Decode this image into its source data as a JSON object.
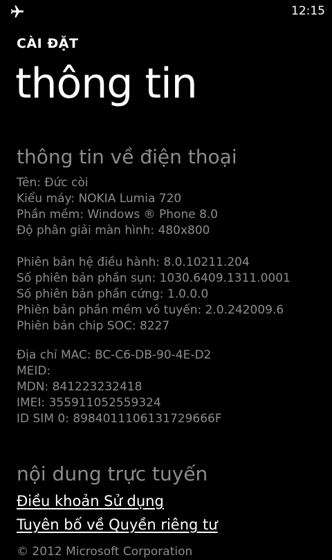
{
  "status_bar": {
    "airplane_icon": "airplane-icon",
    "time": "12:15"
  },
  "header": {
    "app_title": "CÀI ĐẶT",
    "page_title": "thông tin"
  },
  "phone_info": {
    "section_title": "thông tin về điện thoại",
    "basic": [
      "Tên: Đức còi",
      "Kiểu máy: NOKIA Lumia 720",
      "Phần mềm: Windows ® Phone 8.0",
      "Độ phân giải màn hình: 480x800"
    ],
    "versions": [
      "Phiên bản hệ điều hành: 8.0.10211.204",
      "Số phiên bản phần sụn: 1030.6409.1311.0001",
      "Số phiên bản phần cứng: 1.0.0.0",
      "Phiên bản phần mềm vô tuyến: 2.0.242009.6",
      "Phiên bản chip SOC: 8227"
    ],
    "identifiers": [
      "Địa chỉ MAC: BC-C6-DB-90-4E-D2",
      "MEID:",
      "MDN: 841223232418",
      "IMEI: 355911052559324",
      "ID SIM 0: 8984011106131729666F"
    ]
  },
  "online_content": {
    "section_title": "nội dung trực tuyến",
    "terms_link": "Điều khoản Sử dụng",
    "privacy_link": "Tuyên bố về Quyền riêng tư"
  },
  "footer": {
    "copyright": "© 2012 Microsoft Corporation"
  }
}
